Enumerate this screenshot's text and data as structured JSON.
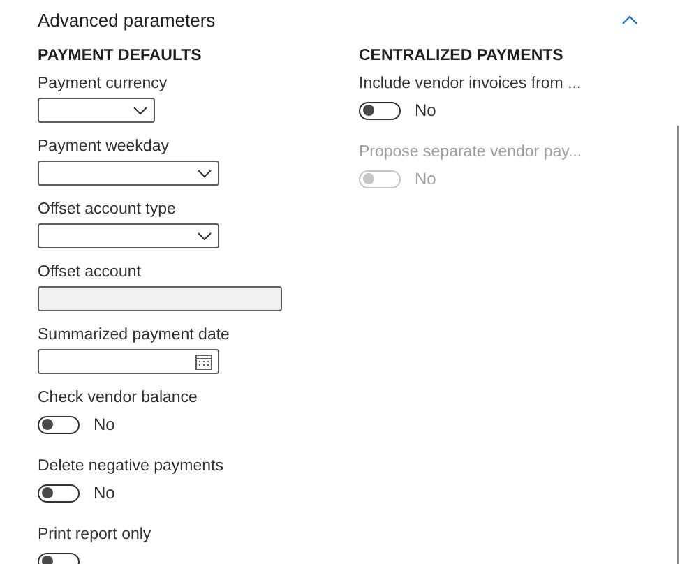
{
  "section": {
    "title": "Advanced parameters",
    "expanded": true
  },
  "columns": [
    {
      "heading": "PAYMENT DEFAULTS",
      "fields": [
        {
          "kind": "dropdown",
          "label": "Payment currency"
        },
        {
          "kind": "dropdown",
          "label": "Payment weekday"
        },
        {
          "kind": "dropdown",
          "label": "Offset account type"
        },
        {
          "kind": "text",
          "label": "Offset account"
        },
        {
          "kind": "date",
          "label": "Summarized payment date"
        },
        {
          "kind": "toggle",
          "label": "Check vendor balance",
          "on": false,
          "disabled": false,
          "value": "No"
        },
        {
          "kind": "toggle",
          "label": "Delete negative payments",
          "on": false,
          "disabled": false,
          "value": "No"
        },
        {
          "kind": "toggle",
          "label": "Print report only",
          "on": false,
          "disabled": false
        }
      ]
    },
    {
      "heading": "CENTRALIZED PAYMENTS",
      "fields": [
        {
          "kind": "toggle",
          "label": "Include vendor invoices from ...",
          "on": false,
          "disabled": false,
          "value": "No"
        },
        {
          "kind": "toggle",
          "label": "Propose separate vendor pay...",
          "on": false,
          "disabled": true,
          "value": "No"
        }
      ]
    }
  ]
}
